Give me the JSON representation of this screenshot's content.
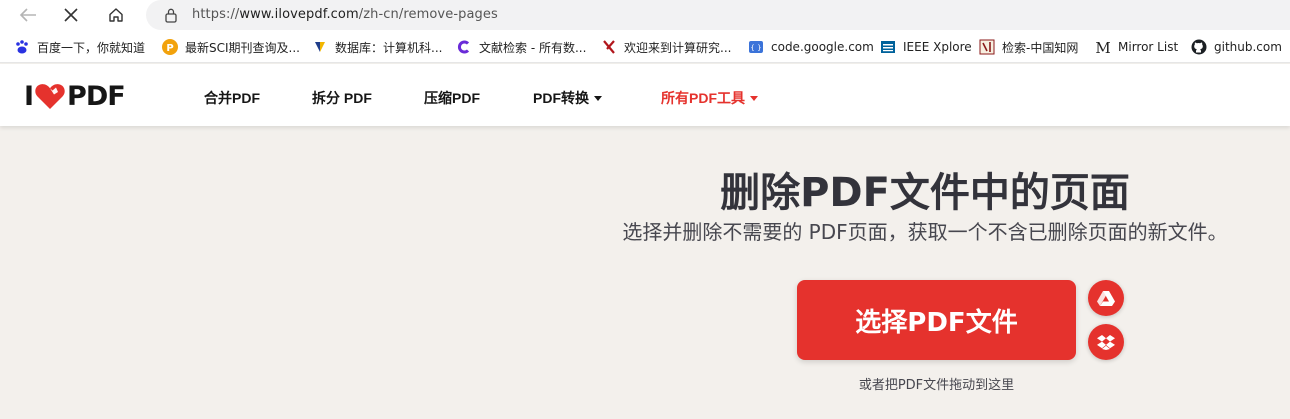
{
  "browser": {
    "url_scheme": "https://",
    "url_host": "www.ilovepdf.com",
    "url_path": "/zh-cn/remove-pages",
    "bookmarks": [
      {
        "label": "百度一下，你就知道",
        "icon": "baidu-paw-icon"
      },
      {
        "label": "最新SCI期刊查询及...",
        "icon": "letter-p-icon"
      },
      {
        "label": "数据库：计算机科...",
        "icon": "database-icon"
      },
      {
        "label": "文献检索 - 所有数...",
        "icon": "search-c-icon"
      },
      {
        "label": "欢迎来到计算研究...",
        "icon": "x-logo-icon"
      },
      {
        "label": "code.google.com",
        "icon": "google-code-icon"
      },
      {
        "label": "IEEE Xplore",
        "icon": "ieee-icon"
      },
      {
        "label": "检索-中国知网",
        "icon": "cnki-icon"
      },
      {
        "label": "Mirror List",
        "icon": "letter-m-icon"
      },
      {
        "label": "github.com",
        "icon": "github-icon"
      }
    ]
  },
  "site": {
    "logo_left": "I",
    "logo_right": "PDF",
    "nav": {
      "merge": "合并PDF",
      "split": "拆分 PDF",
      "compress": "压缩PDF",
      "convert": "PDF转换",
      "all_tools": "所有PDF工具"
    }
  },
  "hero": {
    "title": "删除PDF文件中的页面",
    "subtitle": "选择并删除不需要的 PDF页面，获取一个不含已删除页面的新文件。",
    "select_button": "选择PDF文件",
    "drop_hint": "或者把PDF文件拖动到这里"
  },
  "colors": {
    "brand_red": "#e5322d",
    "page_bg": "#f3f0ec",
    "text_dark": "#33333b"
  }
}
